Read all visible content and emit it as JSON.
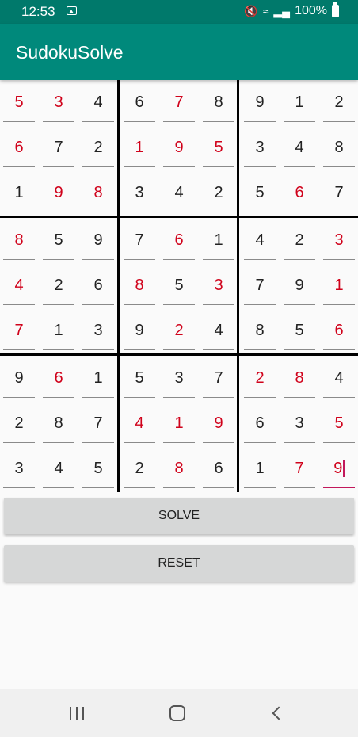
{
  "status": {
    "time": "12:53",
    "battery": "100%",
    "icons": [
      "gallery-icon",
      "mute-icon",
      "wifi-icon",
      "signal-icon",
      "battery-icon"
    ]
  },
  "app": {
    "title": "SudokuSolve"
  },
  "colors": {
    "given": "#222222",
    "solved": "#d0021b",
    "accent": "#c2185b",
    "appbar": "#00897b",
    "statusbar": "#00796b"
  },
  "grid": {
    "rows": [
      [
        [
          "5",
          1
        ],
        [
          "3",
          1
        ],
        [
          "4",
          0
        ],
        [
          "6",
          0
        ],
        [
          "7",
          1
        ],
        [
          "8",
          0
        ],
        [
          "9",
          0
        ],
        [
          "1",
          0
        ],
        [
          "2",
          0
        ]
      ],
      [
        [
          "6",
          1
        ],
        [
          "7",
          0
        ],
        [
          "2",
          0
        ],
        [
          "1",
          1
        ],
        [
          "9",
          1
        ],
        [
          "5",
          1
        ],
        [
          "3",
          0
        ],
        [
          "4",
          0
        ],
        [
          "8",
          0
        ]
      ],
      [
        [
          "1",
          0
        ],
        [
          "9",
          1
        ],
        [
          "8",
          1
        ],
        [
          "3",
          0
        ],
        [
          "4",
          0
        ],
        [
          "2",
          0
        ],
        [
          "5",
          0
        ],
        [
          "6",
          1
        ],
        [
          "7",
          0
        ]
      ],
      [
        [
          "8",
          1
        ],
        [
          "5",
          0
        ],
        [
          "9",
          0
        ],
        [
          "7",
          0
        ],
        [
          "6",
          1
        ],
        [
          "1",
          0
        ],
        [
          "4",
          0
        ],
        [
          "2",
          0
        ],
        [
          "3",
          1
        ]
      ],
      [
        [
          "4",
          1
        ],
        [
          "2",
          0
        ],
        [
          "6",
          0
        ],
        [
          "8",
          1
        ],
        [
          "5",
          0
        ],
        [
          "3",
          1
        ],
        [
          "7",
          0
        ],
        [
          "9",
          0
        ],
        [
          "1",
          1
        ]
      ],
      [
        [
          "7",
          1
        ],
        [
          "1",
          0
        ],
        [
          "3",
          0
        ],
        [
          "9",
          0
        ],
        [
          "2",
          1
        ],
        [
          "4",
          0
        ],
        [
          "8",
          0
        ],
        [
          "5",
          0
        ],
        [
          "6",
          1
        ]
      ],
      [
        [
          "9",
          0
        ],
        [
          "6",
          1
        ],
        [
          "1",
          0
        ],
        [
          "5",
          0
        ],
        [
          "3",
          0
        ],
        [
          "7",
          0
        ],
        [
          "2",
          1
        ],
        [
          "8",
          1
        ],
        [
          "4",
          0
        ]
      ],
      [
        [
          "2",
          0
        ],
        [
          "8",
          0
        ],
        [
          "7",
          0
        ],
        [
          "4",
          1
        ],
        [
          "1",
          1
        ],
        [
          "9",
          1
        ],
        [
          "6",
          0
        ],
        [
          "3",
          0
        ],
        [
          "5",
          1
        ]
      ],
      [
        [
          "3",
          0
        ],
        [
          "4",
          0
        ],
        [
          "5",
          0
        ],
        [
          "2",
          0
        ],
        [
          "8",
          1
        ],
        [
          "6",
          0
        ],
        [
          "1",
          0
        ],
        [
          "7",
          1
        ],
        [
          "9",
          1
        ]
      ]
    ],
    "focused_cell": [
      8,
      8
    ]
  },
  "buttons": {
    "solve": "SOLVE",
    "reset": "RESET"
  },
  "navigation": {
    "icons": [
      "recents-icon",
      "home-icon",
      "back-icon"
    ]
  }
}
